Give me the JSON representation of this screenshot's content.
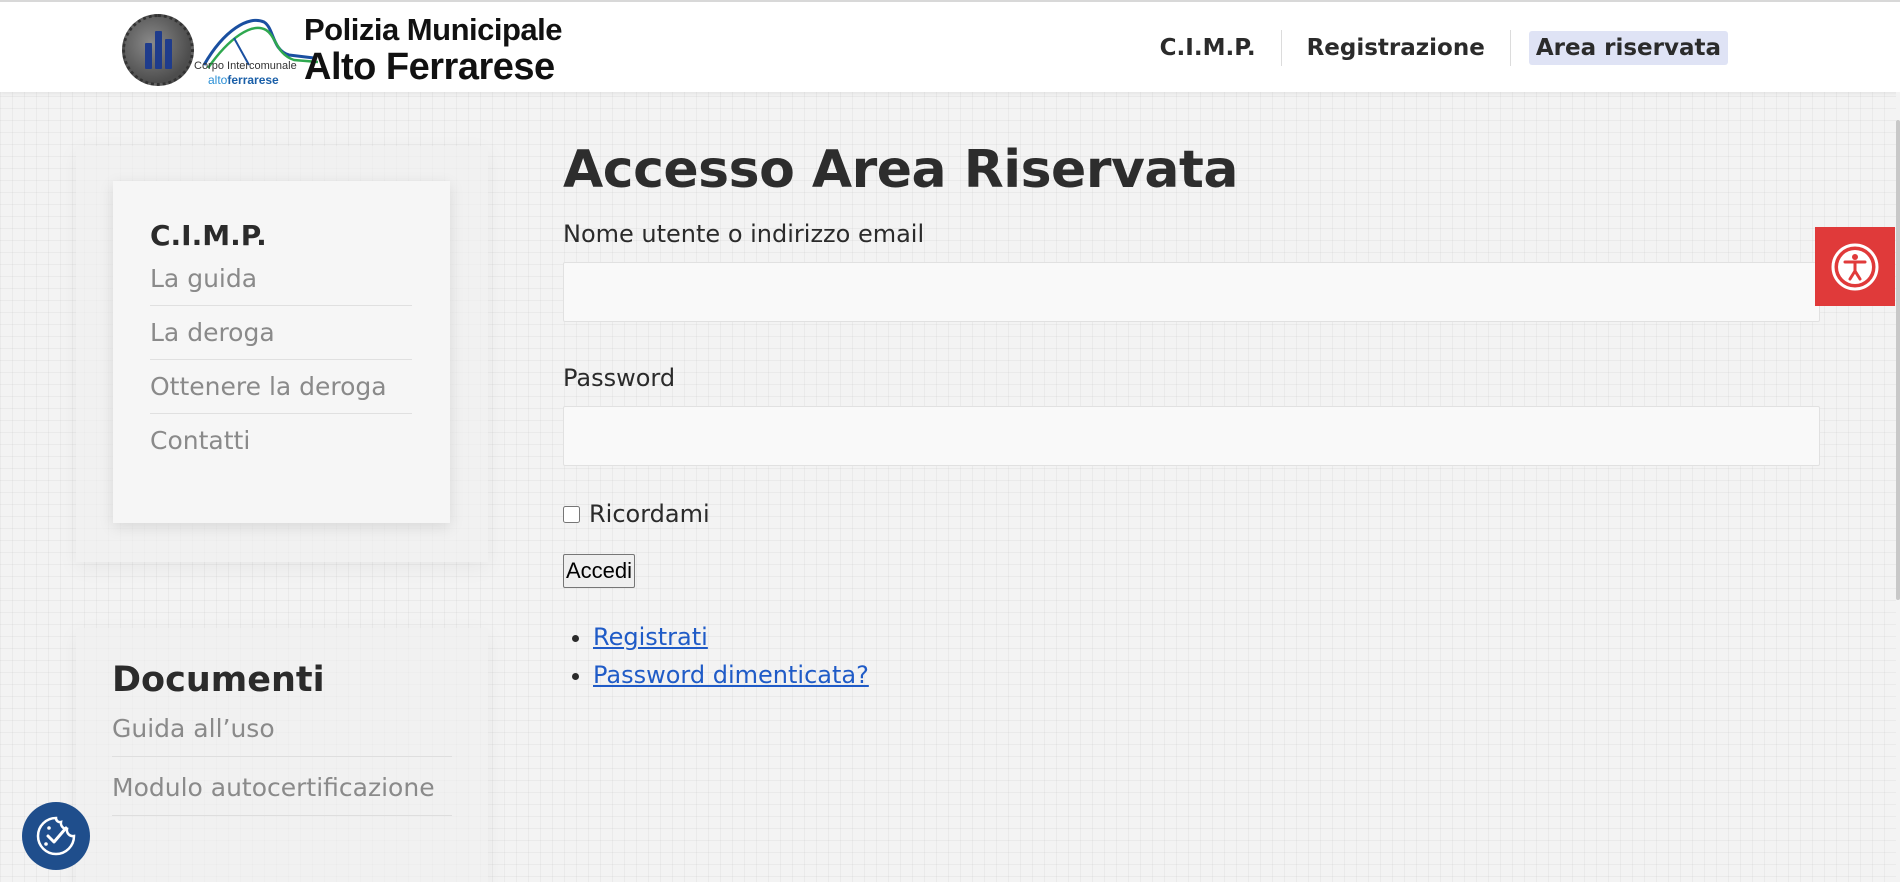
{
  "header": {
    "logo": {
      "subtitle_line1": "Corpo Intercomunale",
      "subtitle_line2_prefix": "alto",
      "subtitle_line2_bold": "ferrarese",
      "title_line1": "Polizia Municipale",
      "title_line2": "Alto Ferrarese"
    },
    "nav": [
      {
        "label": "C.I.M.P."
      },
      {
        "label": "Registrazione"
      },
      {
        "label": "Area riservata"
      }
    ]
  },
  "sidebar": {
    "title": "C.I.M.P.",
    "items": [
      {
        "label": "La guida"
      },
      {
        "label": "La deroga"
      },
      {
        "label": "Ottenere la deroga"
      },
      {
        "label": "Contatti"
      }
    ]
  },
  "documents": {
    "title": "Documenti",
    "items": [
      {
        "label": "Guida all’uso"
      },
      {
        "label": "Modulo autocertificazione"
      }
    ]
  },
  "login": {
    "title": "Accesso Area Riservata",
    "username_label": "Nome utente o indirizzo email",
    "username_value": "",
    "password_label": "Password",
    "password_value": "",
    "remember_label": "Ricordami",
    "submit_label": "Accedi",
    "links": [
      {
        "label": "Registrati"
      },
      {
        "label": "Password dimenticata?"
      }
    ]
  },
  "colors": {
    "accessibility_button": "#e03a3a",
    "cookie_button": "#1f4e8c",
    "link": "#1f5bc7",
    "active_nav_bg": "#dfe3f5"
  },
  "icons": {
    "accessibility": "accessibility-icon",
    "cookie": "cookie-consent-icon"
  }
}
